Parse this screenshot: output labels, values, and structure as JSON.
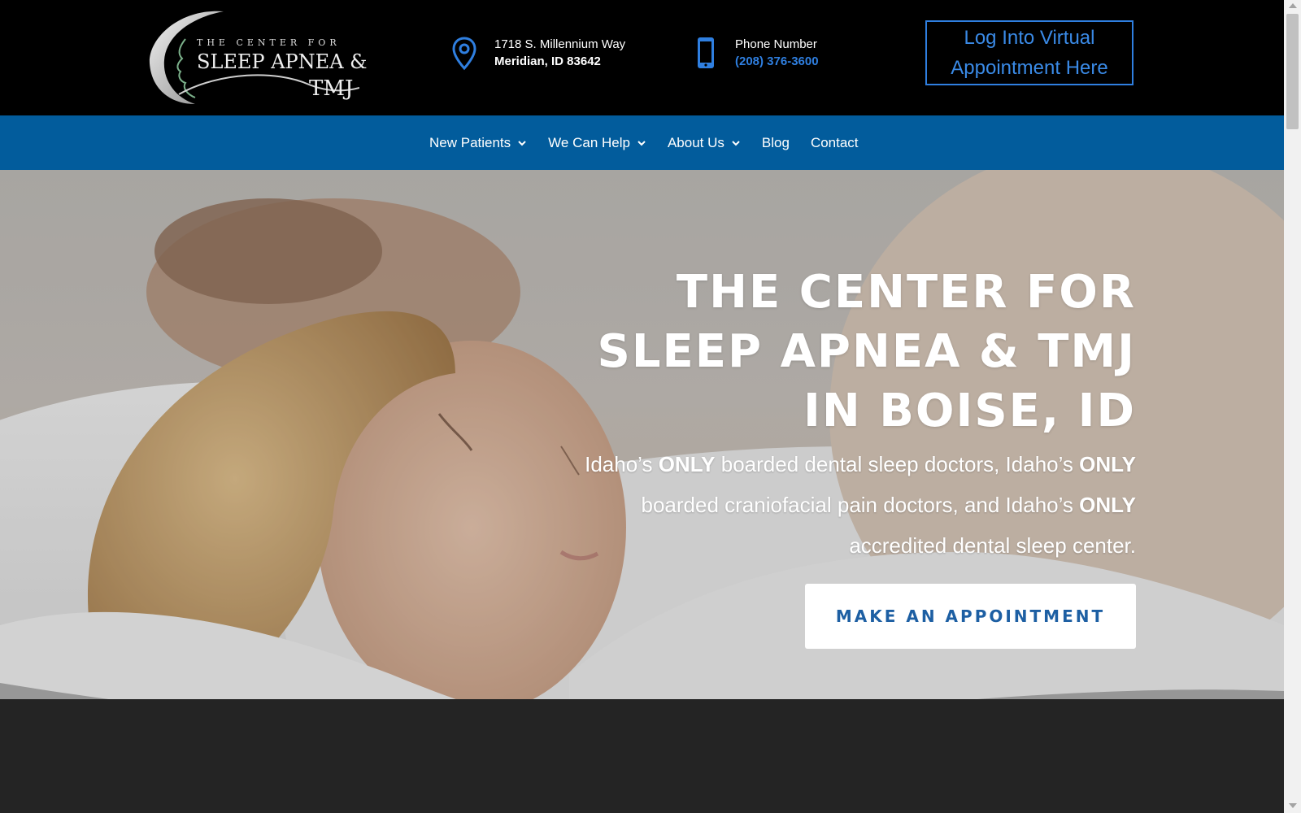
{
  "header": {
    "logo": {
      "line1": "THE CENTER FOR",
      "line2": "SLEEP APNEA &",
      "line3": "TMJ"
    },
    "address": {
      "icon": "map-pin-icon",
      "street": "1718 S. Millennium Way",
      "city": "Meridian, ID 83642"
    },
    "phone": {
      "icon": "mobile-phone-icon",
      "label": "Phone Number",
      "number": "(208) 376-3600"
    },
    "login_button": "Log Into Virtual Appointment Here"
  },
  "nav": {
    "items": [
      {
        "label": "New Patients",
        "has_dropdown": true
      },
      {
        "label": "We Can Help",
        "has_dropdown": true
      },
      {
        "label": "About Us",
        "has_dropdown": true
      },
      {
        "label": "Blog",
        "has_dropdown": false
      },
      {
        "label": "Contact",
        "has_dropdown": false
      }
    ]
  },
  "hero": {
    "title": "THE CENTER FOR SLEEP APNEA & TMJ IN BOISE, ID",
    "subtitle_parts": [
      {
        "text": "Idaho’s ",
        "bold": false
      },
      {
        "text": "ONLY",
        "bold": true
      },
      {
        "text": " boarded dental sleep doctors, Idaho’s ",
        "bold": false
      },
      {
        "text": "ONLY",
        "bold": true
      },
      {
        "text": " boarded craniofacial pain doctors, and Idaho’s ",
        "bold": false
      },
      {
        "text": "ONLY",
        "bold": true
      },
      {
        "text": " accredited dental sleep center.",
        "bold": false
      }
    ],
    "cta_button": "MAKE AN APPOINTMENT"
  },
  "colors": {
    "header_bg": "#000000",
    "nav_bg": "#025c9c",
    "accent_blue": "#2f7fe0",
    "cta_text": "#1d5fa3",
    "footer_band": "#242424"
  }
}
